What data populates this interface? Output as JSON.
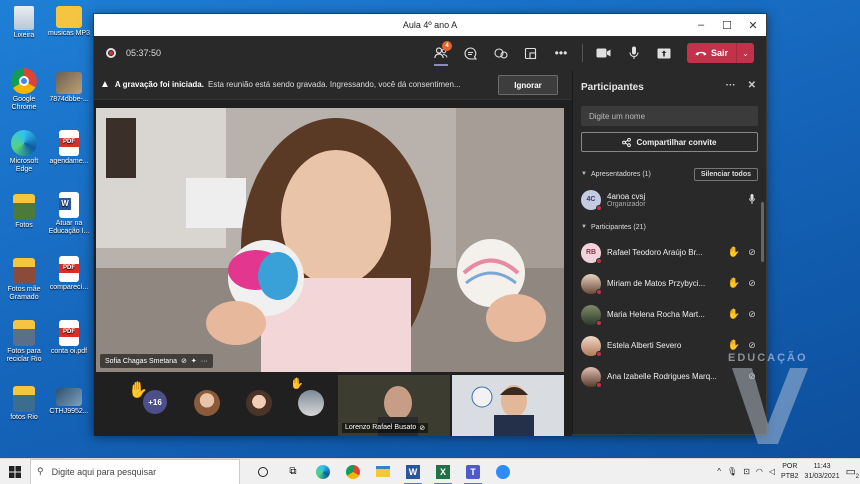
{
  "desktop": {
    "icons": [
      {
        "label": "Lixeira",
        "icon": "recycle-bin-icon"
      },
      {
        "label": "musicas MP3",
        "icon": "folder-icon"
      },
      {
        "label": "Google Chrome",
        "icon": "chrome-icon"
      },
      {
        "label": "7874dbbe-...",
        "icon": "photo-icon"
      },
      {
        "label": "Microsoft Edge",
        "icon": "edge-icon"
      },
      {
        "label": "agendame...",
        "icon": "pdf-icon"
      },
      {
        "label": "Fotos",
        "icon": "folder-photos-icon"
      },
      {
        "label": "Atuar na Educação I...",
        "icon": "word-doc-icon"
      },
      {
        "label": "Fotos mãe Gramado",
        "icon": "folder-photos-icon"
      },
      {
        "label": "comparecí...",
        "icon": "pdf-icon"
      },
      {
        "label": "Fotos para reciclar Rio",
        "icon": "folder-photos-icon"
      },
      {
        "label": "conta oi.pdf",
        "icon": "pdf-icon"
      },
      {
        "label": "fotos Rio",
        "icon": "folder-photos-icon"
      },
      {
        "label": "CTHJ9952...",
        "icon": "photo-icon"
      }
    ]
  },
  "window": {
    "title": "Aula 4º ano A",
    "timer": "05:37:50",
    "participants_badge": "4",
    "leave_label": "Sair"
  },
  "banner": {
    "title": "A gravação foi iniciada.",
    "text": "Esta reunião está sendo gravada. Ingressando, você dá consentimen...",
    "dismiss_label": "Ignorar"
  },
  "stage": {
    "main_name": "Sofia Chagas Smetana",
    "overflow_count": "+16",
    "thumbs": [
      {
        "name": "Lorenzo Rafael Busato"
      },
      {
        "name": ""
      }
    ]
  },
  "panel": {
    "title": "Participantes",
    "search_placeholder": "Digite um nome",
    "share_label": "Compartilhar convite",
    "presenters_header": "Apresentadores (1)",
    "mute_all_label": "Silenciar todos",
    "participants_header": "Participantes (21)",
    "presenters": [
      {
        "initials": "4C",
        "name": "4anoa cvsj",
        "role": "Organizador"
      }
    ],
    "participants": [
      {
        "initials": "RB",
        "name": "Rafael Teodoro Araújo Br...",
        "hand": true
      },
      {
        "initials": "",
        "name": "Miriam de Matos Przybyci...",
        "hand": true
      },
      {
        "initials": "",
        "name": "Maria Helena Rocha Mart...",
        "hand": true
      },
      {
        "initials": "",
        "name": "Estela Alberti Severo",
        "hand": true
      },
      {
        "initials": "",
        "name": "Ana Izabelle Rodrigues Marq...",
        "hand": false
      }
    ]
  },
  "watermark": {
    "text": "EDUCAÇÃO"
  },
  "taskbar": {
    "search_placeholder": "Digite aqui para pesquisar",
    "lang_top": "POR",
    "lang_bottom": "PTB2",
    "time": "11:43",
    "date": "31/03/2021",
    "notifications": "2"
  },
  "colors": {
    "accent": "#6264a7",
    "leave": "#c4314b",
    "desktop": "#1a6fc4"
  }
}
